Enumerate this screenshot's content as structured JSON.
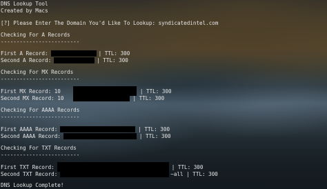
{
  "terminal": {
    "title_line": "DNS Lookup Tool",
    "credit_line": "Created by Macs",
    "prompt_line": "[?] Please Enter The Domain You'd Like To Lookup: syndicatedintel.com",
    "separator": "-------------------------",
    "a_records": {
      "heading": "Checking For A Records",
      "first_label": "First A Record:",
      "first_ttl": "| TTL: 300",
      "second_label": "Second A Record:",
      "second_ttl": "| TTL: 300"
    },
    "mx_records": {
      "heading": "Checking For MX Records",
      "first_label": "First MX Record: 10",
      "first_ttl": "| TTL: 300",
      "second_label": "Second MX Record: 10",
      "second_ttl": "| TTL: 300"
    },
    "aaaa_records": {
      "heading": "Checking For AAAA Records",
      "first_label": "First AAAA Record:",
      "first_ttl": "| TTL: 300",
      "second_label": "Second AAAA Record:",
      "second_ttl": "| TTL: 300"
    },
    "txt_records": {
      "heading": "Checking For TXT Records",
      "first_label": "First TXT Record:",
      "first_ttl": "| TTL: 300",
      "second_label": "Second TXT Record:",
      "second_suffix": "~all | TTL: 300"
    },
    "complete_line": "DNS Lookup Complete!"
  },
  "colors": {
    "text": "#e6e6e6",
    "redaction": "#000000"
  }
}
